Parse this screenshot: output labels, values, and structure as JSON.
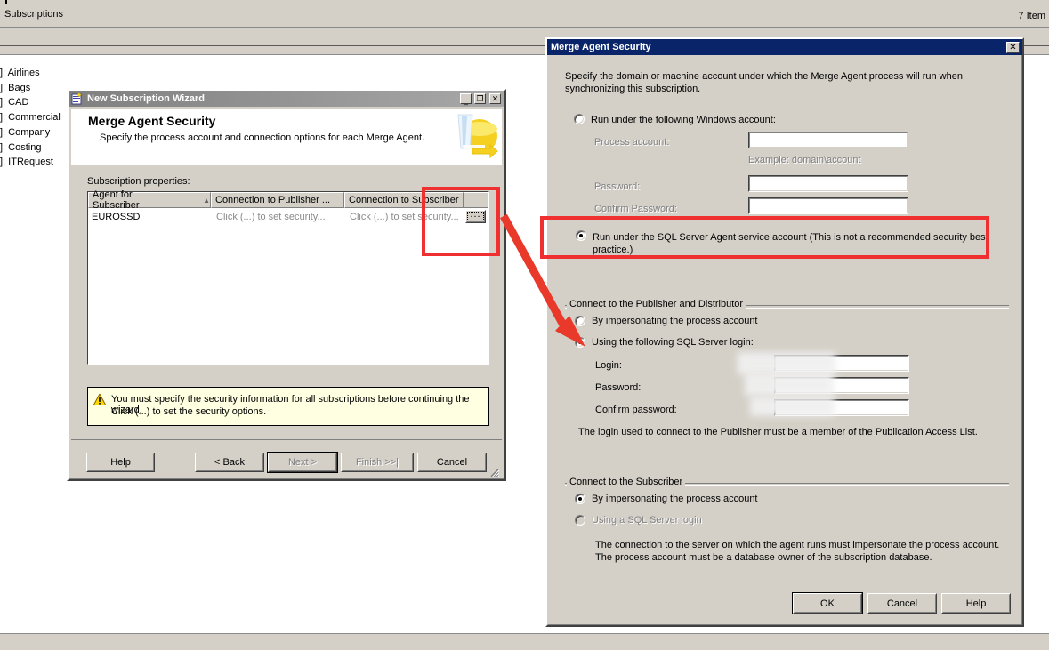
{
  "background": {
    "topbar_title": "Subscriptions",
    "item_count": "7 Item",
    "list_items": [
      {
        "prefix": "]:",
        "label": "Airlines"
      },
      {
        "prefix": "]:",
        "label": "Bags"
      },
      {
        "prefix": "]:",
        "label": "CAD"
      },
      {
        "prefix": "]:",
        "label": "Commercial"
      },
      {
        "prefix": "]:",
        "label": "Company"
      },
      {
        "prefix": "]:",
        "label": "Costing"
      },
      {
        "prefix": "]:",
        "label": "ITRequest"
      }
    ]
  },
  "wizard": {
    "title": "New Subscription Wizard",
    "minimize_label": "_",
    "maximize_label": "❐",
    "close_label": "✕",
    "banner_title": "Merge Agent Security",
    "banner_subtitle": "Specify the process account and connection options for each Merge Agent.",
    "table_caption": "Subscription properties:",
    "table": {
      "columns": [
        "Agent for Subscriber",
        "Connection to Publisher ...",
        "Connection to Subscriber",
        ""
      ],
      "sort_indicator": "▲",
      "rows": [
        {
          "agent": "EUROSSD",
          "publisher": "Click (...) to set security...",
          "subscriber": "Click (...) to set security...",
          "ellipsis_button": "..."
        }
      ]
    },
    "warning": {
      "line1": "You must specify the security information for all subscriptions before continuing the wizard.",
      "line2": "Click (...) to set the security options."
    },
    "buttons": {
      "help": "Help",
      "back": "< Back",
      "next": "Next >",
      "finish": "Finish >>|",
      "cancel": "Cancel"
    }
  },
  "merge_agent_security": {
    "title": "Merge Agent Security",
    "close_label": "✕",
    "description_line1": "Specify the domain or machine account under which the Merge Agent process will run when",
    "description_line2": "synchronizing this subscription.",
    "windows_account": {
      "radio_label": "Run under the following Windows account:",
      "selected": false,
      "process_account_label": "Process account:",
      "process_account_value": "",
      "example_hint": "Example: domain\\account",
      "password_label": "Password:",
      "password_value": "",
      "confirm_password_label": "Confirm Password:",
      "confirm_password_value": ""
    },
    "sql_agent_account": {
      "radio_label": "Run under the SQL Server Agent service account (This is not a recommended security best practice.)",
      "selected": true
    },
    "publisher_group": {
      "title": "Connect to the Publisher and Distributor",
      "option_impersonate": "By impersonating the process account",
      "option_impersonate_selected": false,
      "option_sql_login": "Using the following SQL Server login:",
      "option_sql_login_selected": true,
      "login_label": "Login:",
      "login_value": "",
      "password_label": "Password:",
      "password_value": "",
      "confirm_password_label": "Confirm password:",
      "confirm_password_value": "",
      "note": "The login used to connect to the Publisher must be a member of the Publication Access List."
    },
    "subscriber_group": {
      "title": "Connect to the Subscriber",
      "option_impersonate": "By impersonating the process account",
      "option_impersonate_selected": true,
      "option_sql_login": "Using a SQL Server login",
      "option_sql_login_selected": false,
      "option_sql_login_disabled": true,
      "note_line1": "The connection to the server on which the agent runs must impersonate the process account.",
      "note_line2": "The process account must be a database owner of the subscription database."
    },
    "buttons": {
      "ok": "OK",
      "cancel": "Cancel",
      "help": "Help"
    }
  },
  "annotations": {
    "highlight_color": "#f03030",
    "box_table_ellipsis": "highlight-around-ellipsis-button",
    "box_sql_agent_radio": "highlight-around-sql-agent-service-account-option",
    "arrow": "arrow-from-ellipsis-button-to-sql-server-login-option"
  }
}
